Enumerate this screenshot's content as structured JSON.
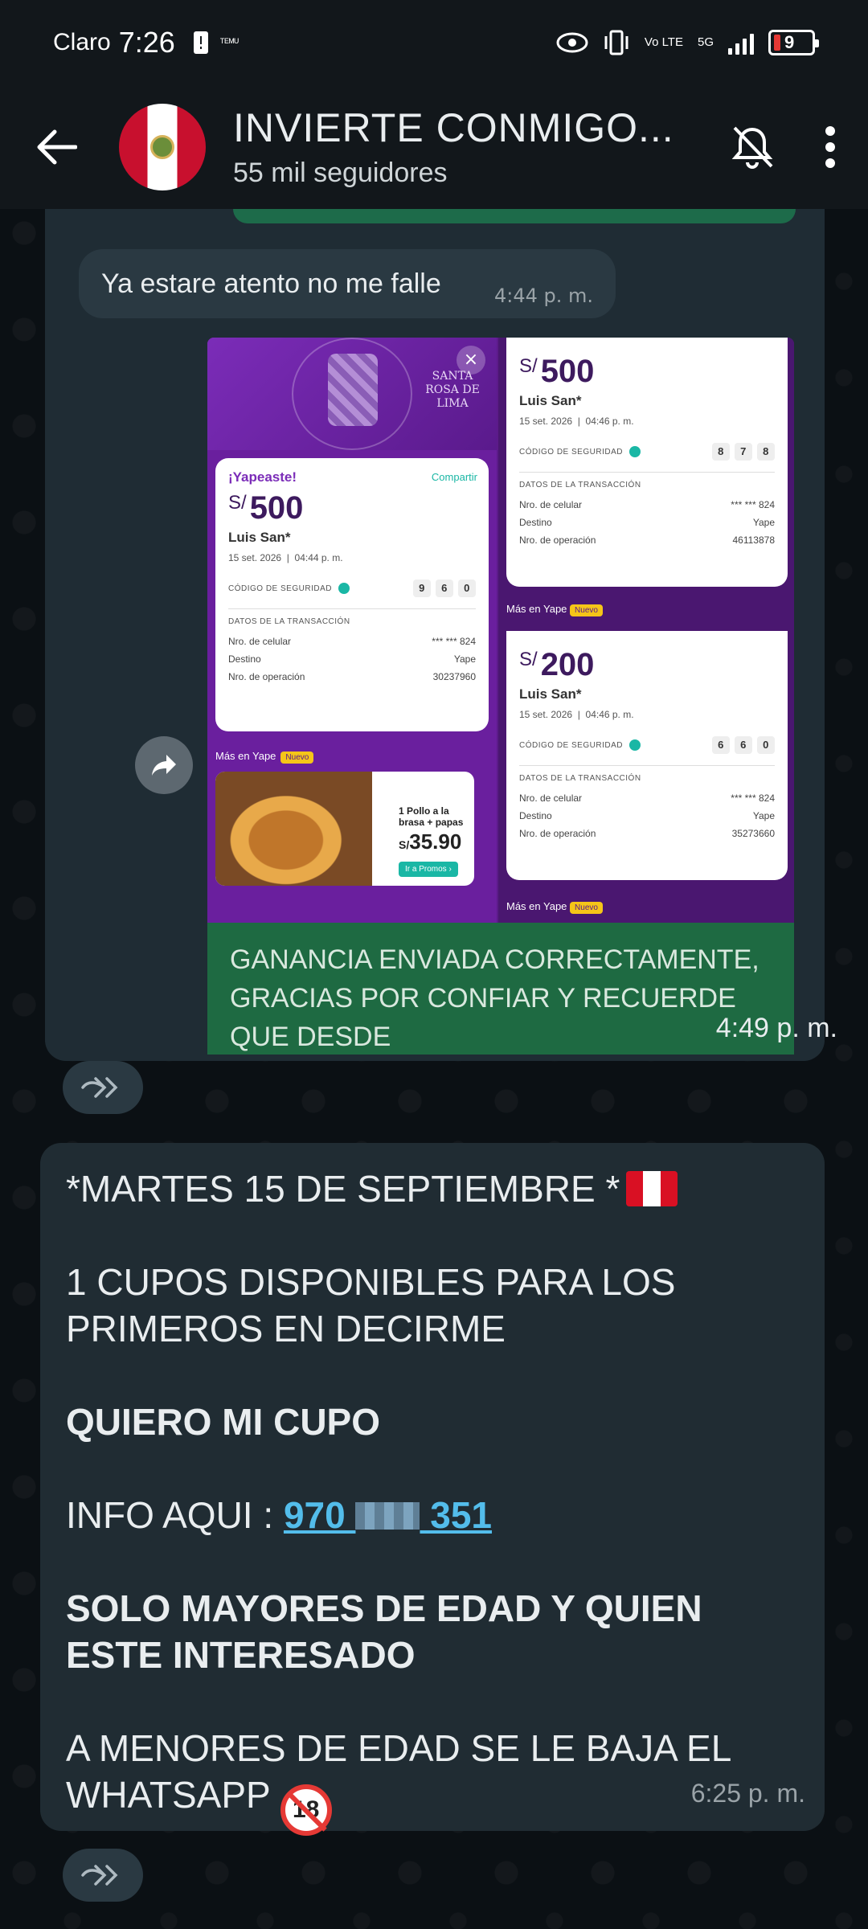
{
  "status_bar": {
    "carrier": "Claro",
    "time": "7:26",
    "mini_icon_label": "ᵀᴱᴹᵁ",
    "network": "5G",
    "volte": "Vo LTE",
    "battery": "9"
  },
  "header": {
    "title": "INVIERTE CONMIGO...",
    "subtitle": "55 mil seguidores"
  },
  "reply_message": {
    "text": "Ya estare atento no me falle",
    "time": "4:44 p. m."
  },
  "media": {
    "poster_text": "SANTA ROSA DE LIMA",
    "close": "×",
    "card_main": {
      "title": "¡Yapeaste!",
      "share": "Compartir",
      "currency": "S/",
      "amount": "500",
      "name": "Luis San*",
      "date": "15 set. 2026",
      "hour": "04:44 p. m.",
      "security_label": "CÓDIGO DE SEGURIDAD",
      "codes": [
        "9",
        "6",
        "0"
      ],
      "data_label": "DATOS DE LA TRANSACCIÓN",
      "rows": [
        {
          "k": "Nro. de celular",
          "v": "*** *** 824"
        },
        {
          "k": "Destino",
          "v": "Yape"
        },
        {
          "k": "Nro. de operación",
          "v": "30237960"
        }
      ]
    },
    "card_top_right": {
      "currency": "S/",
      "amount": "500",
      "name": "Luis San*",
      "date": "15 set. 2026",
      "hour": "04:46 p. m.",
      "security_label": "CÓDIGO DE SEGURIDAD",
      "codes": [
        "8",
        "7",
        "8"
      ],
      "data_label": "DATOS DE LA TRANSACCIÓN",
      "rows": [
        {
          "k": "Nro. de celular",
          "v": "*** *** 824"
        },
        {
          "k": "Destino",
          "v": "Yape"
        },
        {
          "k": "Nro. de operación",
          "v": "46113878"
        }
      ]
    },
    "card_bottom_right": {
      "currency": "S/",
      "amount": "200",
      "name": "Luis San*",
      "date": "15 set. 2026",
      "hour": "04:46 p. m.",
      "security_label": "CÓDIGO DE SEGURIDAD",
      "codes": [
        "6",
        "6",
        "0"
      ],
      "data_label": "DATOS DE LA TRANSACCIÓN",
      "rows": [
        {
          "k": "Nro. de celular",
          "v": "*** *** 824"
        },
        {
          "k": "Destino",
          "v": "Yape"
        },
        {
          "k": "Nro. de operación",
          "v": "35273660"
        }
      ]
    },
    "promo": {
      "mas": "Más en Yape",
      "nuevo": "Nuevo",
      "text": "1 Pollo a la brasa + papas",
      "price_prefix": "S/",
      "price": "35.90",
      "button": "Ir a Promos ›"
    },
    "caption": "GANANCIA ENVIADA CORRECTAMENTE, GRACIAS POR CONFIAR Y RECUERDE QUE DESDE",
    "caption_time": "4:49 p. m."
  },
  "message2": {
    "line1": "*MARTES 15 DE SEPTIEMBRE *",
    "line2": "1 CUPOS DISPONIBLES PARA LOS PRIMEROS EN DECIRME",
    "line3": "QUIERO MI CUPO",
    "info_label": "INFO AQUI : ",
    "phone_start": "970 ",
    "phone_end": " 351",
    "line5": "SOLO MAYORES DE EDAD Y QUIEN ESTE INTERESADO",
    "line6": "A MENORES DE EDAD SE LE BAJA EL WHATSAPP",
    "age_badge": "18",
    "time": "6:25 p. m."
  },
  "colors": {
    "chat_bg": "#0b1014",
    "bubble": "#202c33",
    "link": "#53bdeb",
    "caption_green": "#1e6a42",
    "yape_purple": "#6a1f9e"
  }
}
